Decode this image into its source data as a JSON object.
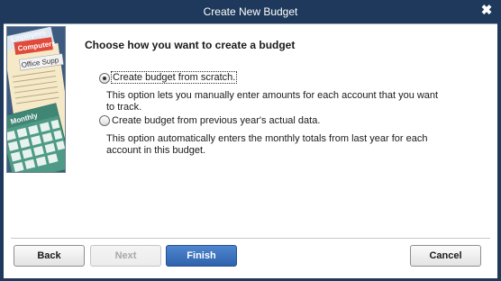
{
  "window": {
    "title": "Create New Budget",
    "close_glyph": "✖"
  },
  "illustration": {
    "folder_tabs": [
      "Employees",
      "Computers",
      "Office Supp"
    ],
    "calendar_label": "Monthly",
    "colors": {
      "folder": "#f5e9c8",
      "tab": "#e04a3a",
      "calendar": "#4f9a86",
      "background": "#3d5b80"
    }
  },
  "main": {
    "heading": "Choose how you want to create a budget",
    "options": [
      {
        "label": "Create budget from scratch.",
        "selected": true,
        "description": "This option lets you manually enter amounts for each account that you want to track."
      },
      {
        "label": "Create budget from previous year's actual data.",
        "selected": false,
        "description": "This option automatically enters the monthly totals from last year for each account in this budget."
      }
    ]
  },
  "buttons": {
    "back": {
      "label": "Back",
      "mnemonic": "k"
    },
    "next": {
      "label": "Next"
    },
    "finish": {
      "label": "Finish",
      "mnemonic": "F"
    },
    "cancel": {
      "label": "Cancel"
    }
  },
  "colors": {
    "titlebar": "#1e395b",
    "primary_button": "#2e62ad"
  }
}
